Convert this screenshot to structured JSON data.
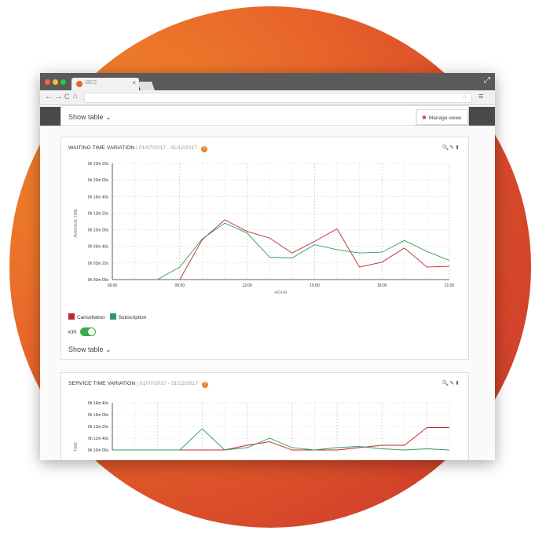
{
  "browser": {
    "tab_title": "BES",
    "tab_close": "×",
    "nav_back": "←",
    "nav_forward": "→",
    "nav_reload": "C",
    "nav_home": "⌂",
    "star": "☆",
    "menu": "≡",
    "expand": "⤢"
  },
  "toolbar": {
    "show_table_top": "Show table",
    "manage_views_label": "Manage views"
  },
  "card1": {
    "title": "WAITING TIME VARIATION",
    "range": "| 01/07/2017 - 31/12/2017",
    "help": "?",
    "tools": "🔍✎⬇",
    "legend": [
      "Cancellation",
      "Subscription"
    ],
    "kpi_label": "KPI",
    "show_table": "Show table"
  },
  "card2": {
    "title": "SERVICE TIME VARIATION",
    "range": "| 01/07/2017 - 31/12/2017",
    "help": "?",
    "tools": "🔍✎⬇"
  },
  "colors": {
    "cancellation": "#c0282d",
    "subscription": "#2a9d6a",
    "accent": "#e8652a"
  },
  "chart_data": [
    {
      "type": "line",
      "title": "WAITING TIME VARIATION",
      "xlabel": "HOUR",
      "ylabel": "AVERAGE TIME",
      "xlim": [
        6,
        21
      ],
      "ylim": [
        0,
        1400
      ],
      "x_ticks": [
        "06:00",
        "09:00",
        "12:00",
        "15:00",
        "18:00",
        "21:00"
      ],
      "x_tick_values": [
        6,
        9,
        12,
        15,
        18,
        21
      ],
      "y_ticks": [
        "0h 00m 00s",
        "0h 03m 20s",
        "0h 06m 40s",
        "0h 10m 00s",
        "0h 13m 20s",
        "0h 16m 40s",
        "0h 20m 00s",
        "0h 23m 20s"
      ],
      "y_tick_values": [
        0,
        200,
        400,
        600,
        800,
        1000,
        1200,
        1400
      ],
      "grid": true,
      "legend_position": "bottom-left",
      "series": [
        {
          "name": "Cancellation",
          "color": "#c0282d",
          "x": [
            9,
            10,
            11,
            12,
            13,
            14,
            15,
            16,
            17,
            18,
            19,
            20,
            21
          ],
          "y": [
            0,
            480,
            720,
            580,
            500,
            320,
            460,
            610,
            150,
            210,
            380,
            150,
            160
          ]
        },
        {
          "name": "Subscription",
          "color": "#2a9d6a",
          "x": [
            8,
            9,
            10,
            11,
            12,
            13,
            14,
            15,
            16,
            17,
            18,
            19,
            20,
            21
          ],
          "y": [
            0,
            150,
            490,
            680,
            560,
            270,
            260,
            420,
            360,
            320,
            330,
            470,
            340,
            230
          ]
        }
      ]
    },
    {
      "type": "line",
      "title": "SERVICE TIME VARIATION",
      "ylabel": "TIME",
      "ylim": [
        600,
        1000
      ],
      "y_ticks": [
        "0h 10m 00s",
        "0h 11m 40s",
        "0h 13m 20s",
        "0h 15m 00s",
        "0h 16m 40s"
      ],
      "y_tick_values": [
        600,
        700,
        800,
        900,
        1000
      ],
      "grid": true,
      "series": [
        {
          "name": "Cancellation",
          "color": "#c0282d",
          "x": [
            6,
            7,
            8,
            9,
            10,
            11,
            12,
            13,
            14,
            15,
            16,
            17,
            18,
            19,
            20,
            21
          ],
          "y": [
            560,
            560,
            560,
            560,
            560,
            560,
            640,
            670,
            560,
            560,
            560,
            620,
            640,
            640,
            790,
            790
          ]
        },
        {
          "name": "Subscription",
          "color": "#2a9d6a",
          "x": [
            6,
            7,
            8,
            9,
            10,
            11,
            12,
            13,
            14,
            15,
            16,
            17,
            18,
            19,
            20,
            21
          ],
          "y": [
            600,
            600,
            600,
            600,
            780,
            590,
            620,
            700,
            620,
            600,
            620,
            630,
            610,
            600,
            610,
            600
          ]
        }
      ]
    }
  ]
}
